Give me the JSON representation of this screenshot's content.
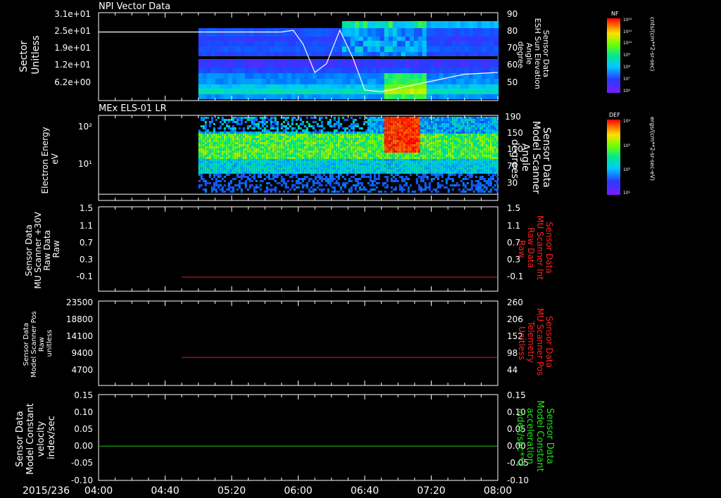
{
  "date_label": "2015/236",
  "time_axis": {
    "range": [
      "04:00",
      "08:00"
    ],
    "tick_labels": [
      "04:00",
      "04:40",
      "05:20",
      "06:00",
      "06:40",
      "07:20",
      "08:00"
    ]
  },
  "panels": [
    {
      "title": "NPI Vector Data",
      "left_label": [
        "Sector",
        "Unitless"
      ],
      "left_ticks": [
        "3.1e+01",
        "2.5e+01",
        "1.9e+01",
        "1.2e+01",
        "6.2e+00"
      ],
      "right_label": [
        "Sensor Data",
        "ESH Sun Elevation",
        "Angle",
        "degree"
      ],
      "right_ticks": [
        "90",
        "80",
        "70",
        "60",
        "50"
      ],
      "colorbar": {
        "title": "NF",
        "tick_labels": [
          "10¹²",
          "10¹¹",
          "10¹⁰",
          "10⁹",
          "10⁸",
          "10⁷",
          "10⁶"
        ],
        "units": "cnts/(cm**2-sr-sec)"
      }
    },
    {
      "title": "MEx ELS-01 LR",
      "left_label": [
        "Electron Energy",
        "eV"
      ],
      "left_ticks": [
        "10²",
        "10¹"
      ],
      "right_label": [
        "Sensor Data",
        "Model Scanner",
        "Angle",
        "degrees"
      ],
      "right_ticks": [
        "190",
        "150",
        "110",
        "70",
        "30"
      ],
      "colorbar": {
        "title": "DEF",
        "tick_labels": [
          "10⁴",
          "10³",
          "10²",
          "10¹"
        ],
        "units": "ergs/(cm**2-sr-sec-eV)"
      }
    },
    {
      "left_label": [
        "Sensor Data",
        "MU Scanner +30V",
        "Raw Data",
        "Raw"
      ],
      "left_ticks": [
        "1.5",
        "1.1",
        "0.7",
        "0.3",
        "-0.1"
      ],
      "right_label": [
        "Sensor Data",
        "MU Scanner Int",
        "Raw Data",
        "Raw"
      ],
      "right_ticks": [
        "1.5",
        "1.1",
        "0.7",
        "0.3",
        "-0.1"
      ]
    },
    {
      "left_label": [
        "Sensor Data",
        "Model Scanner Pos",
        "Raw",
        "unitless"
      ],
      "left_ticks": [
        "23500",
        "18800",
        "14100",
        "9400",
        "4700"
      ],
      "right_label": [
        "Sensor Data",
        "MU Scanner Pos",
        "Telemetry",
        "Unitless"
      ],
      "right_ticks": [
        "260",
        "206",
        "152",
        "98",
        "44"
      ]
    },
    {
      "left_label": [
        "Sensor Data",
        "Model Constant",
        "velocity",
        "index/sec"
      ],
      "left_ticks": [
        "0.15",
        "0.10",
        "0.05",
        "0.00",
        "-0.05",
        "-0.10"
      ],
      "right_label": [
        "Sensor Data",
        "Model Constant",
        "acceleration",
        "index/sec**2"
      ],
      "right_ticks": [
        "0.15",
        "0.10",
        "0.05",
        "0.00",
        "-0.05",
        "-0.10"
      ]
    }
  ],
  "colors": {
    "background": "#000000",
    "axes": "#ffffff",
    "red_label": "#ff2020",
    "green_label": "#20e020",
    "red_line": "#e02020",
    "green_line": "#20c020"
  },
  "chart_data": [
    {
      "type": "heatmap",
      "title": "NPI Vector Data",
      "x_range": [
        "04:00",
        "08:00"
      ],
      "y_label": "Sector Unitless",
      "color_scale": "log",
      "data_start": "05:00",
      "overlay_series": {
        "name": "Sensor Data ESH Sun Elevation Angle",
        "units": "degree",
        "x": [
          "04:00",
          "05:50",
          "05:57",
          "06:03",
          "06:10",
          "06:17",
          "06:25",
          "06:33",
          "06:40",
          "06:50",
          "07:00",
          "07:20",
          "07:40",
          "08:00"
        ],
        "y": [
          79,
          79,
          80,
          72,
          56,
          61,
          80,
          64,
          46,
          45,
          47,
          51,
          55,
          56
        ]
      }
    },
    {
      "type": "heatmap",
      "title": "MEx ELS-01 LR",
      "x_range": [
        "04:00",
        "08:00"
      ],
      "ylabel": "Electron Energy eV",
      "y_scale": "log",
      "color_scale": "log",
      "data_start": "05:00",
      "overlay_series": {
        "name": "Sensor Data Model Scanner Angle",
        "units": "degrees",
        "x": [
          "04:00",
          "08:00"
        ],
        "y": [
          14,
          14
        ]
      }
    },
    {
      "type": "line",
      "x_range": [
        "04:00",
        "08:00"
      ],
      "ylim": [
        -0.3,
        1.5
      ],
      "series": [
        {
          "name": "Sensor Data MU Scanner Int Raw Data",
          "x": [
            "04:50",
            "08:00"
          ],
          "y": [
            0,
            0
          ]
        }
      ]
    },
    {
      "type": "line",
      "x_range": [
        "04:00",
        "08:00"
      ],
      "ylim": [
        0,
        23500
      ],
      "series": [
        {
          "name": "Sensor Data MU Scanner Pos Telemetry",
          "x": [
            "04:50",
            "08:00"
          ],
          "y": [
            7800,
            7800
          ]
        }
      ]
    },
    {
      "type": "line",
      "x_range": [
        "04:00",
        "08:00"
      ],
      "ylim": [
        -0.1,
        0.15
      ],
      "series": [
        {
          "name": "Sensor Data Model Constant acceleration",
          "x": [
            "04:00",
            "08:00"
          ],
          "y": [
            0,
            0
          ]
        }
      ]
    }
  ]
}
